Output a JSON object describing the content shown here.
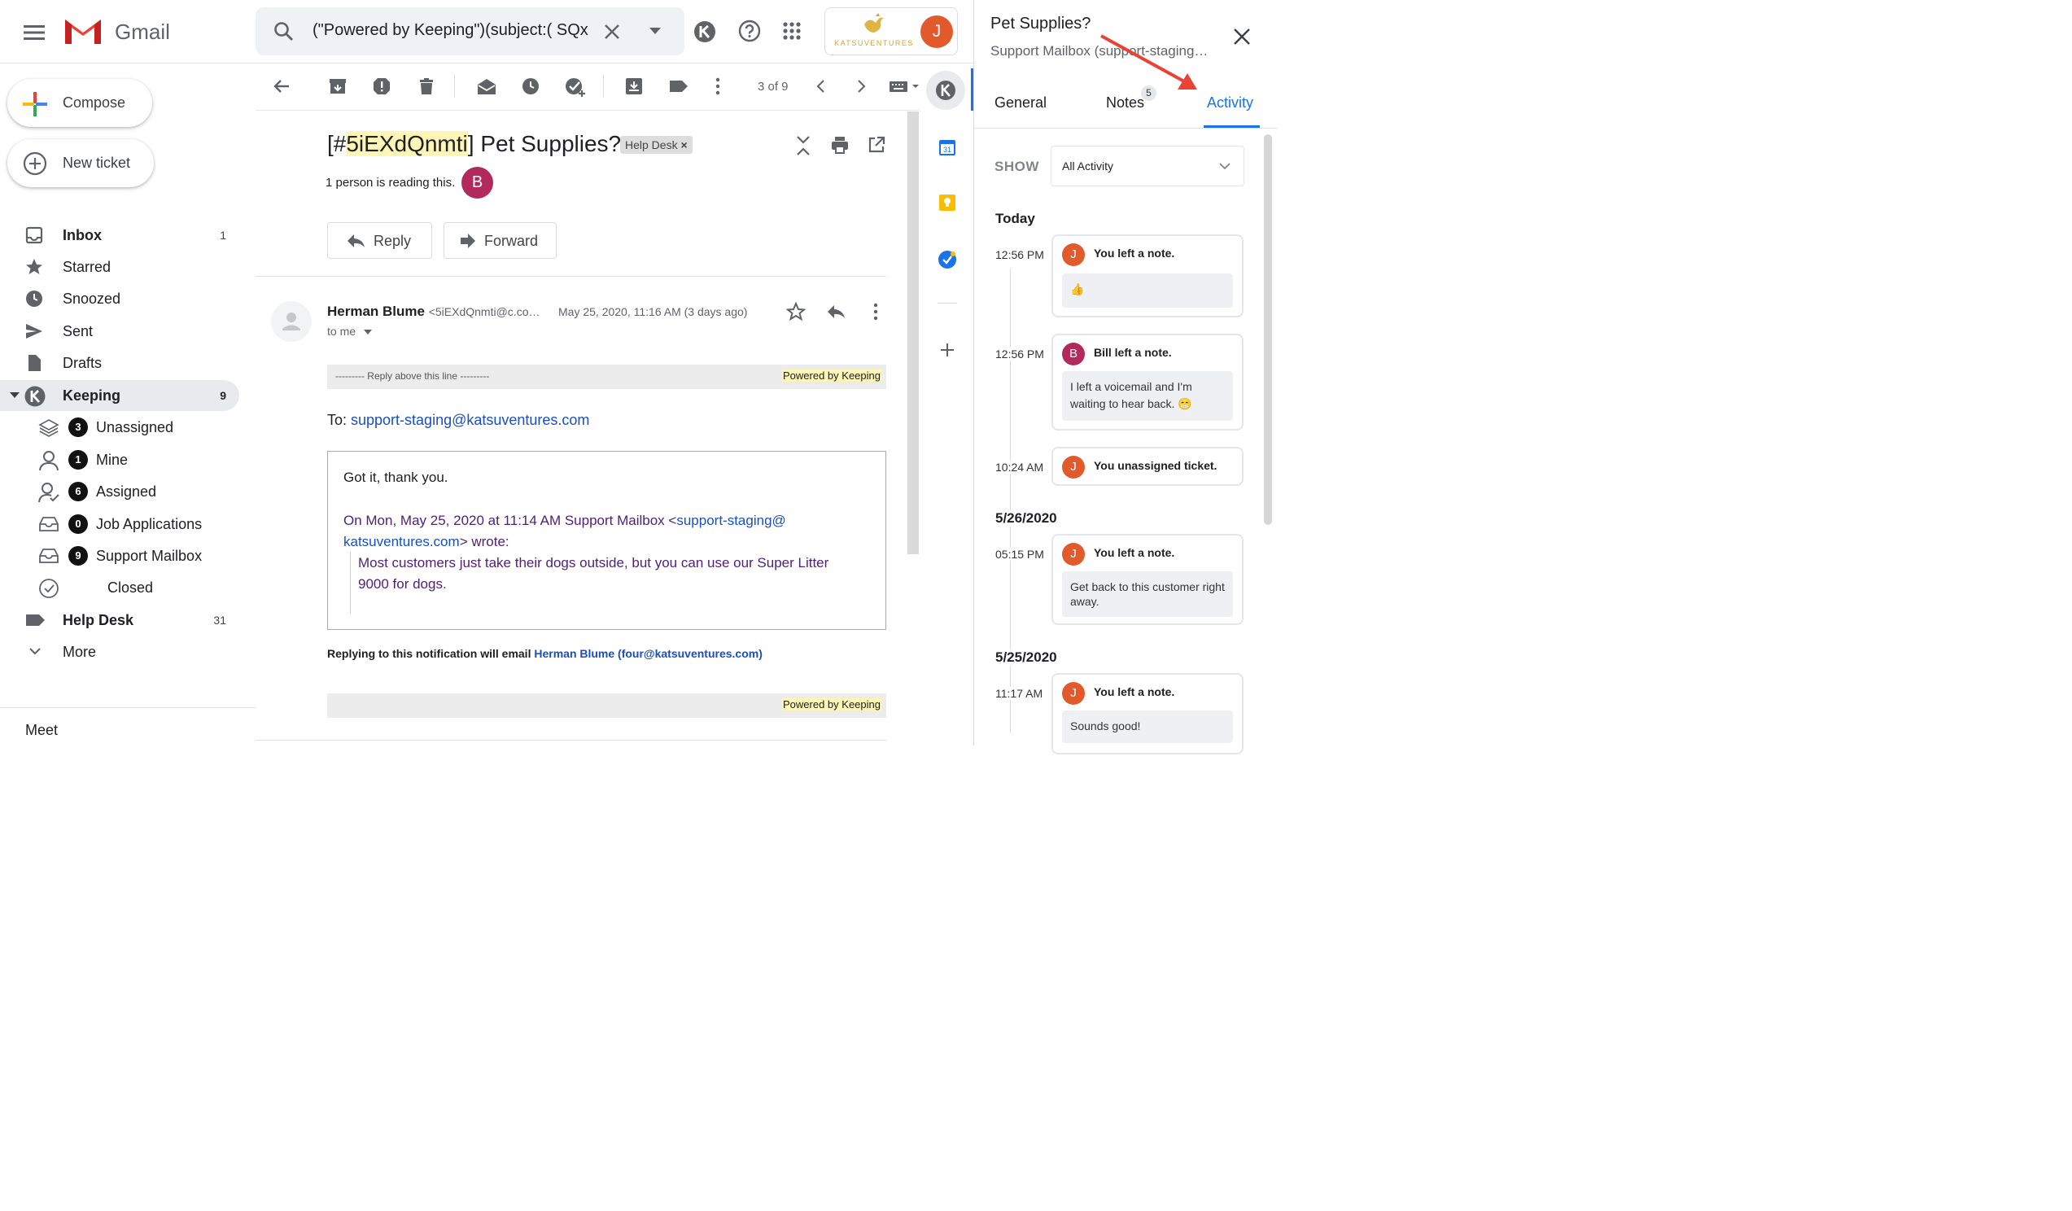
{
  "app": {
    "name": "Gmail"
  },
  "search": {
    "query": "(\"Powered by Keeping\")(subject:( SQx"
  },
  "brand": {
    "logo_text": "KATSUVENTURES",
    "avatar": "J"
  },
  "compose": {
    "compose_label": "Compose",
    "new_ticket_label": "New ticket"
  },
  "nav": [
    {
      "label": "Inbox",
      "count": "1",
      "bold": true
    },
    {
      "label": "Starred",
      "count": ""
    },
    {
      "label": "Snoozed",
      "count": ""
    },
    {
      "label": "Sent",
      "count": ""
    },
    {
      "label": "Drafts",
      "count": ""
    },
    {
      "label": "Keeping",
      "count": "9",
      "bold": true
    },
    {
      "label": "Unassigned",
      "count": "3"
    },
    {
      "label": "Mine",
      "count": "1"
    },
    {
      "label": "Assigned",
      "count": "6"
    },
    {
      "label": "Job Applications",
      "count": "0"
    },
    {
      "label": "Support Mailbox",
      "count": "9"
    },
    {
      "label": "Closed",
      "count": ""
    },
    {
      "label": "Help Desk",
      "count": "31",
      "bold": true
    },
    {
      "label": "More",
      "count": ""
    }
  ],
  "meet_label": "Meet",
  "toolbar": {
    "pager": "3 of 9"
  },
  "email": {
    "subject_prefix": "[#",
    "subject_id": "5iEXdQnmti",
    "subject_rest": "] Pet Supplies?",
    "label_chip": "Help Desk",
    "readers": "1 person is reading this.",
    "reader_avatar": "B",
    "reply_label": "Reply",
    "forward_label": "Forward",
    "sender_name": "Herman Blume",
    "sender_email": "<5iEXdQnmti@c.co…",
    "date": "May 25, 2020, 11:16 AM (3 days ago)",
    "to_me": "to me",
    "reply_line": "--------- Reply above this line ---------",
    "powered": "Powered by Keeping",
    "to_prefix": "To: ",
    "to_addr": "support-staging@katsuventures.com",
    "body_line1": "Got it, thank you.",
    "quote_intro_a": "On Mon, May 25, 2020 at 11:14 AM Support Mailbox <",
    "quote_link1": "support-staging@",
    "quote_link2": "katsuventures.com",
    "quote_intro_b": "> wrote:",
    "quote_text": "Most customers just take their dogs outside, but you can use our Super Litter 9000 for dogs.",
    "notify_text": "Replying to this notification will email ",
    "notify_link": "Herman Blume (four@katsuventures.com)",
    "powered2": "Powered by Keeping"
  },
  "panel": {
    "title": "Pet Supplies?",
    "subtitle": "Support Mailbox (support-staging…",
    "tabs": {
      "general": "General",
      "notes": "Notes",
      "notes_count": "5",
      "activity": "Activity"
    },
    "show_label": "SHOW",
    "show_value": "All Activity",
    "groups": [
      {
        "date": "Today"
      },
      {
        "date": "5/26/2020"
      },
      {
        "date": "5/25/2020"
      }
    ],
    "items": [
      {
        "time": "12:56 PM",
        "avatar": "J",
        "color": "#e25a2b",
        "title": "You left a note.",
        "body": "👍"
      },
      {
        "time": "12:56 PM",
        "avatar": "B",
        "color": "#b22a5b",
        "title": "Bill left a note.",
        "body": "I left a voicemail and I'm waiting to hear back. 😁"
      },
      {
        "time": "10:24 AM",
        "avatar": "J",
        "color": "#e25a2b",
        "title": "You unassigned ticket.",
        "body": ""
      },
      {
        "time": "05:15 PM",
        "avatar": "J",
        "color": "#e25a2b",
        "title": "You left a note.",
        "body": "Get back to this customer right away."
      },
      {
        "time": "11:17 AM",
        "avatar": "J",
        "color": "#e25a2b",
        "title": "You left a note.",
        "body": "Sounds good!"
      }
    ]
  },
  "colors": {
    "accent": "#1a73e8",
    "gmail_red": "#ea4335",
    "arrow": "#ea4335",
    "highlight": "#fdf6b7"
  }
}
